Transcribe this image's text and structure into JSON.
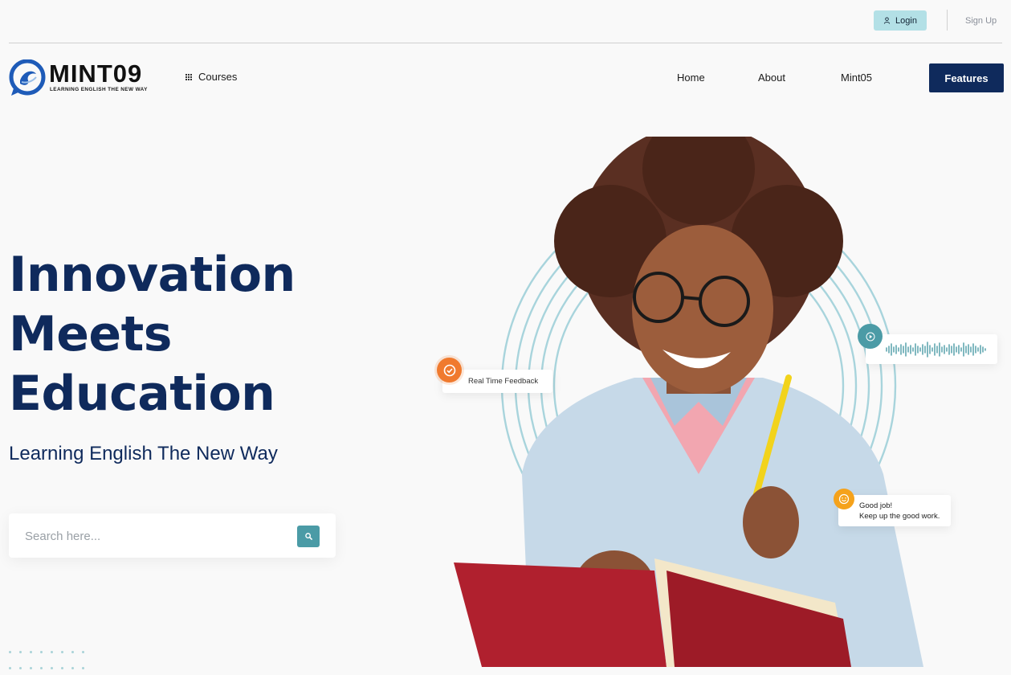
{
  "topbar": {
    "login_label": "Login",
    "signup_label": "Sign Up"
  },
  "logo": {
    "wordmark": "MINT09",
    "tagline": "LEARNING ENGLISH THE NEW WAY"
  },
  "nav": {
    "courses_label": "Courses",
    "links": [
      "Home",
      "About",
      "Mint05"
    ],
    "cta_label": "Features"
  },
  "hero": {
    "title_lines": [
      "Innovation",
      "Meets",
      "Education"
    ],
    "subtitle": "Learning English The New Way",
    "search_placeholder": "Search here..."
  },
  "floating_cards": {
    "feedback": "Real Time Feedback",
    "good_job_line1": "Good job!",
    "good_job_line2": "Keep up the good work."
  },
  "colors": {
    "brand_navy": "#0f2a5c",
    "accent_teal": "#4b9ba6",
    "login_bg": "#b3e0e6",
    "orange": "#f07a2e",
    "yellow": "#f5a21b"
  },
  "icons": {
    "login": "user-icon",
    "courses": "grid-icon",
    "search": "search-icon",
    "feedback": "check-circle-icon",
    "audio": "play-icon",
    "good_job": "smile-icon"
  }
}
